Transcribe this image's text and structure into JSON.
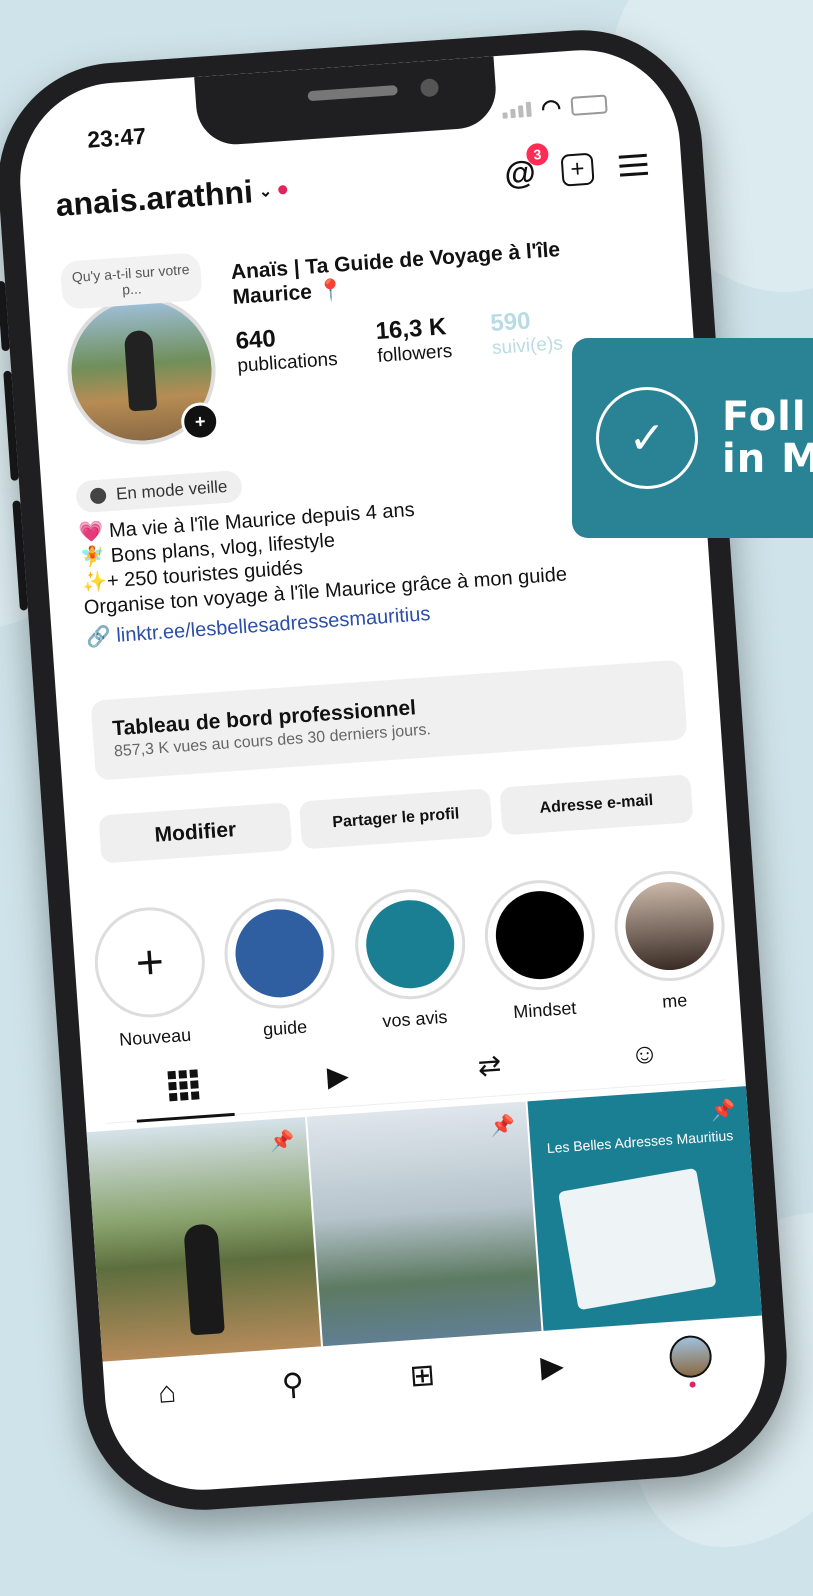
{
  "status_bar": {
    "time": "23:47"
  },
  "header": {
    "username": "anais.arathni",
    "notification_count": "3"
  },
  "profile": {
    "story_bubble": "Qu'y a-t-il sur votre p...",
    "display_name": "Anaïs | Ta Guide de Voyage à l'île Maurice 📍",
    "stats": [
      {
        "value": "640",
        "label": "publications"
      },
      {
        "value": "16,3 K",
        "label": "followers"
      },
      {
        "value": "590",
        "label": "suivi(e)s"
      }
    ]
  },
  "bio": {
    "sleep_mode": "En mode veille",
    "lines": [
      "💗 Ma vie à l'île Maurice depuis 4 ans",
      "🧚 Bons plans, vlog, lifestyle",
      "✨+ 250 touristes guidés",
      "Organise ton voyage à l'île Maurice grâce à mon guide"
    ],
    "link": "linktr.ee/lesbellesadressesmauritius"
  },
  "dashboard": {
    "title": "Tableau de bord professionnel",
    "subtitle": "857,3 K vues au cours des 30 derniers jours."
  },
  "buttons": {
    "edit": "Modifier",
    "share": "Partager le profil",
    "email": "Adresse e-mail"
  },
  "highlights": [
    {
      "label": "Nouveau"
    },
    {
      "label": "guide"
    },
    {
      "label": "vos avis"
    },
    {
      "label": "Mindset"
    },
    {
      "label": "me"
    }
  ],
  "posts": {
    "post3_title": "Les Belles Adresses Mauritius"
  },
  "callout": {
    "text_line1": "Foll",
    "text_line2": "in M"
  },
  "colors": {
    "accent": "#2a8295",
    "badge": "#ff2d55",
    "link": "#2b4ea8"
  }
}
